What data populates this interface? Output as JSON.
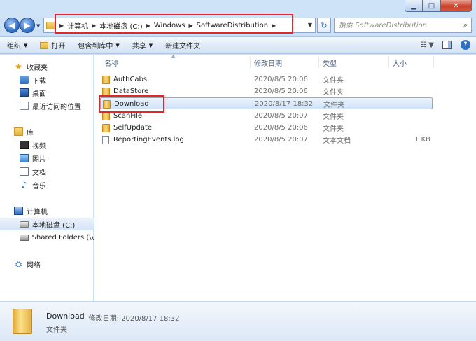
{
  "window": {
    "min_glyph": "▁",
    "max_glyph": "□",
    "close_glyph": "✕"
  },
  "nav": {
    "back_glyph": "◀",
    "forward_glyph": "▶",
    "refresh_glyph": "↻"
  },
  "address": {
    "crumbs": [
      "计算机",
      "本地磁盘 (C:)",
      "Windows",
      "SoftwareDistribution"
    ]
  },
  "search": {
    "placeholder": "搜索 SoftwareDistribution",
    "icon": "search-icon"
  },
  "toolbar": {
    "organize": "组织",
    "open": "打开",
    "include_in_library": "包含到库中",
    "share": "共享",
    "new_folder": "新建文件夹"
  },
  "columns": {
    "name": "名称",
    "date": "修改日期",
    "type": "类型",
    "size": "大小"
  },
  "sidebar": {
    "favorites": "收藏夹",
    "downloads": "下载",
    "desktop": "桌面",
    "recent": "最近访问的位置",
    "libraries": "库",
    "videos": "视频",
    "pictures": "图片",
    "documents": "文档",
    "music": "音乐",
    "computer": "计算机",
    "local_disk": "本地磁盘 (C:)",
    "shared_folders": "Shared Folders (\\\\",
    "network": "网络"
  },
  "files": [
    {
      "name": "AuthCabs",
      "date": "2020/8/5 20:06",
      "type": "文件夹",
      "size": ""
    },
    {
      "name": "DataStore",
      "date": "2020/8/5 20:06",
      "type": "文件夹",
      "size": ""
    },
    {
      "name": "Download",
      "date": "2020/8/17 18:32",
      "type": "文件夹",
      "size": ""
    },
    {
      "name": "ScanFile",
      "date": "2020/8/5 20:07",
      "type": "文件夹",
      "size": ""
    },
    {
      "name": "SelfUpdate",
      "date": "2020/8/5 20:06",
      "type": "文件夹",
      "size": ""
    },
    {
      "name": "ReportingEvents.log",
      "date": "2020/8/5 20:07",
      "type": "文本文档",
      "size": "1 KB"
    }
  ],
  "details": {
    "name": "Download",
    "meta": "修改日期: 2020/8/17 18:32",
    "type": "文件夹"
  },
  "colors": {
    "highlight_box": "#e8232b",
    "selection": "#cfe3fa"
  }
}
